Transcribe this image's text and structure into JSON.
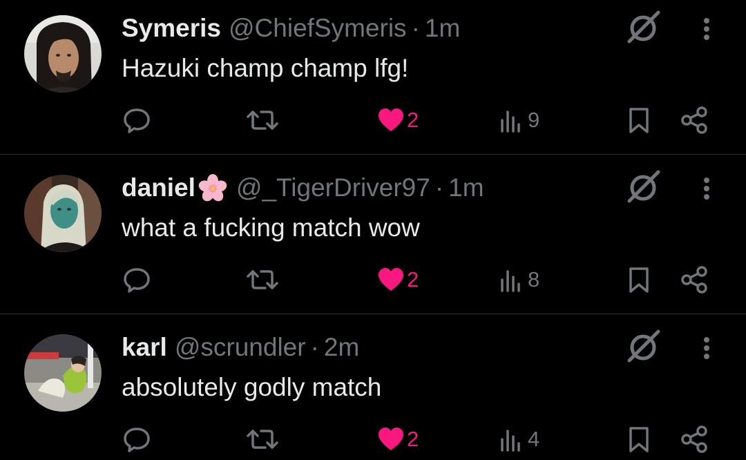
{
  "colors": {
    "background": "#000000",
    "primary_text": "#e7e9ea",
    "secondary_text": "#71767b",
    "like_active": "#f91880",
    "divider": "#2f3336"
  },
  "icons": {
    "reply": "reply-icon",
    "retweet": "retweet-icon",
    "like": "heart-filled-icon",
    "views": "views-chart-icon",
    "bookmark": "bookmark-icon",
    "share": "share-icon",
    "grok": "grok-icon",
    "more": "more-vertical-icon"
  },
  "tweets": [
    {
      "name": "Symeris",
      "handle": "@ChiefSymeris",
      "separator": "·",
      "time": "1m",
      "text": "Hazuki champ champ lfg!",
      "likes": "2",
      "views": "9",
      "liked": true
    },
    {
      "name": "daniel",
      "name_emoji": "cherry-blossom",
      "handle": "@_TigerDriver97",
      "separator": "·",
      "time": "1m",
      "text": "what a fucking match wow",
      "likes": "2",
      "views": "8",
      "liked": true
    },
    {
      "name": "karl",
      "handle": "@scrundler",
      "separator": "·",
      "time": "2m",
      "text": "absolutely godly match",
      "likes": "2",
      "views": "4",
      "liked": true
    }
  ]
}
